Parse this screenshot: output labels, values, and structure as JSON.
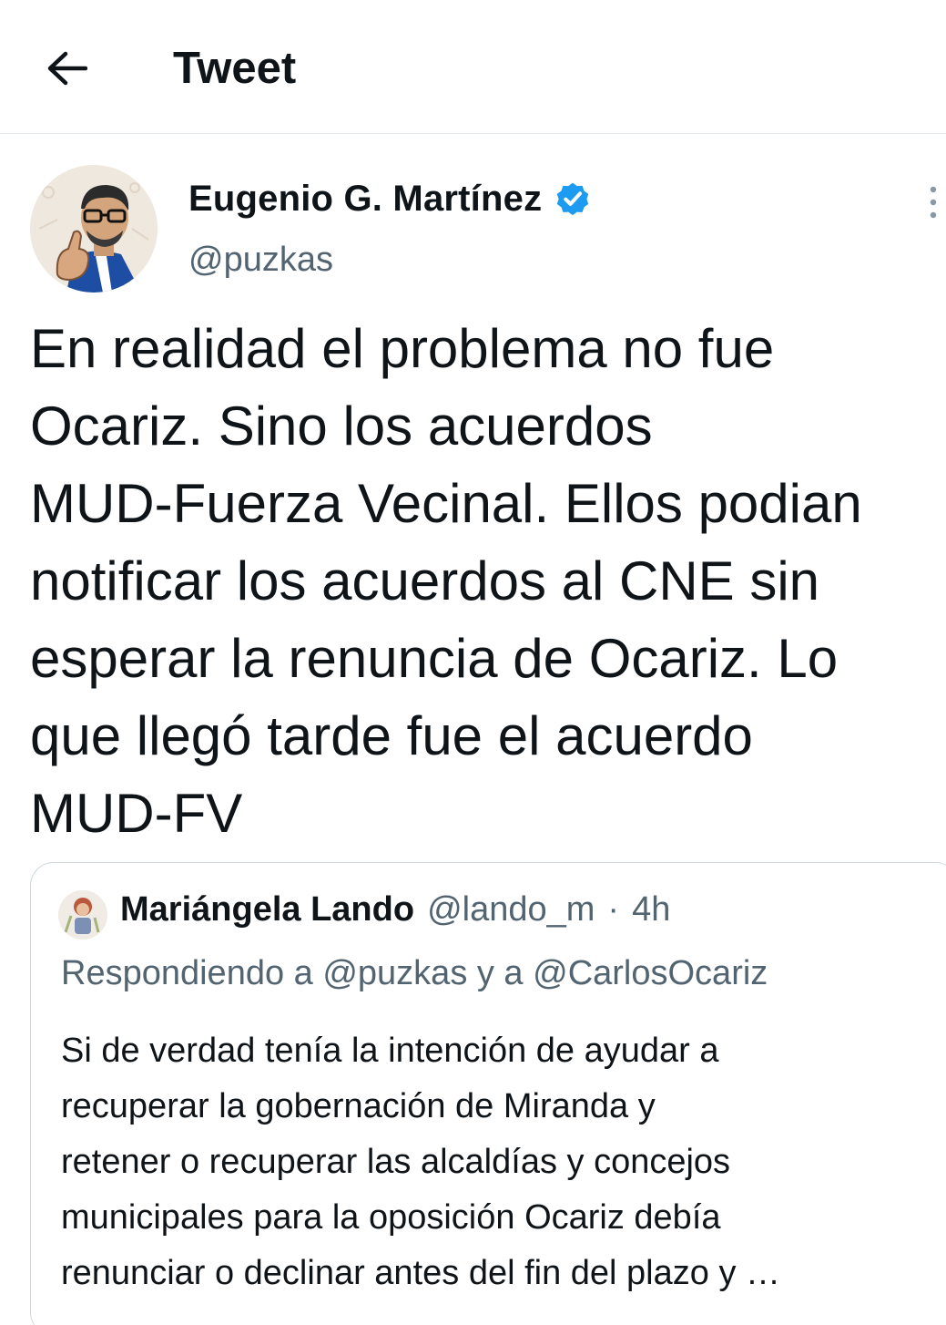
{
  "header": {
    "back_icon": "arrow-left-icon",
    "title": "Tweet"
  },
  "tweet": {
    "author_name": "Eugenio G. Martínez",
    "verified_icon": "verified-badge-icon",
    "author_handle": "@puzkas",
    "more_icon": "more-vertical-icon",
    "text": "En realidad el problema no fue\nOcariz. Sino los acuerdos\nMUD-Fuerza Vecinal. Ellos podian\nnotificar los acuerdos al CNE sin\nesperar la renuncia de Ocariz. Lo\nque llegó tarde fue el acuerdo\nMUD-FV"
  },
  "quoted_tweet": {
    "author_name": "Mariángela Lando",
    "author_handle": "@lando_m",
    "separator": "·",
    "time": "4h",
    "reply_to": "Respondiendo a @puzkas y a @CarlosOcariz",
    "text": "Si de verdad tenía la intención de ayudar a\nrecuperar la gobernación de Miranda y\nretener o recuperar las alcaldías y concejos\nmunicipales para la oposición Ocariz debía\nrenunciar o declinar antes del fin del plazo y …"
  },
  "colors": {
    "text_primary": "#0f1419",
    "text_secondary": "#536471",
    "verified_blue": "#1d9bf0",
    "border": "#cfd9de"
  }
}
